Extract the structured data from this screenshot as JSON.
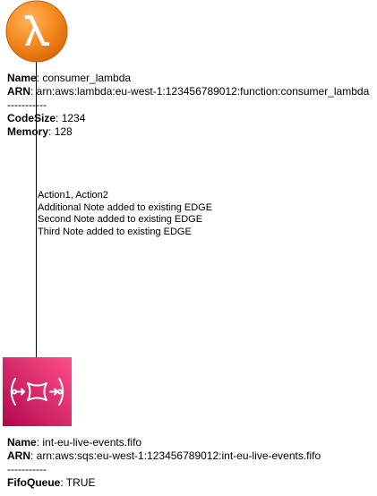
{
  "lambda": {
    "icon": "aws-lambda-icon",
    "color": "#ED7100",
    "fields": [
      {
        "key": "Name",
        "value": "consumer_lambda"
      },
      {
        "key": "ARN",
        "value": "arn:aws:lambda:eu-west-1:123456789012:function:consumer_lambda"
      }
    ],
    "separator": "-----------",
    "extra": [
      {
        "key": "CodeSize",
        "value": "1234"
      },
      {
        "key": "Memory",
        "value": "128"
      }
    ]
  },
  "edge": {
    "labels": [
      "Action1, Action2",
      "Additional Note added to existing EDGE",
      "Second Note added to existing EDGE",
      "Third Note added to existing EDGE"
    ]
  },
  "sqs": {
    "icon": "aws-sqs-icon",
    "color": "#E7157B",
    "fields": [
      {
        "key": "Name",
        "value": "int-eu-live-events.fifo"
      },
      {
        "key": "ARN",
        "value": "arn:aws:sqs:eu-west-1:123456789012:int-eu-live-events.fifo"
      }
    ],
    "separator": "-----------",
    "extra": [
      {
        "key": "FifoQueue",
        "value": "TRUE"
      }
    ]
  }
}
